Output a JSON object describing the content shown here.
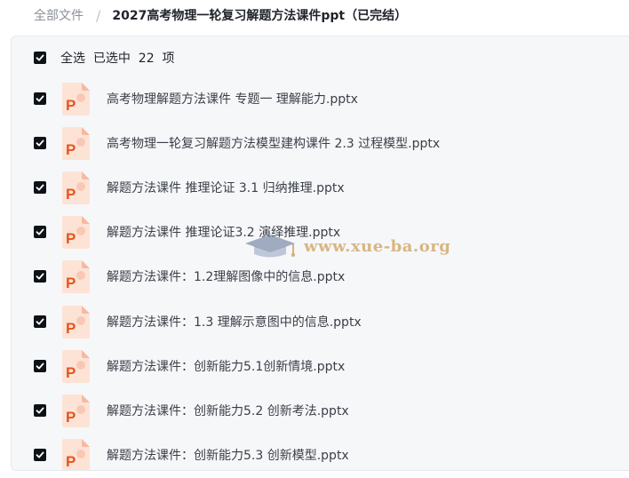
{
  "breadcrumb": {
    "root": "全部文件",
    "separator": "/",
    "current": "2027高考物理一轮复习解题方法课件ppt（已完结）"
  },
  "selection": {
    "label": "全选  已选中  22  项",
    "checked": true
  },
  "files": [
    {
      "name": "高考物理解题方法课件 专题一 理解能力.pptx",
      "icon": "pptx-file-icon",
      "checked": true
    },
    {
      "name": "高考物理一轮复习解题方法模型建构课件 2.3 过程模型.pptx",
      "icon": "pptx-file-icon",
      "checked": true
    },
    {
      "name": "解题方法课件 推理论证 3.1 归纳推理.pptx",
      "icon": "pptx-file-icon",
      "checked": true
    },
    {
      "name": "解题方法课件 推理论证3.2 演绎推理.pptx",
      "icon": "pptx-file-icon",
      "checked": true
    },
    {
      "name": "解题方法课件：1.2理解图像中的信息.pptx",
      "icon": "pptx-file-icon",
      "checked": true
    },
    {
      "name": "解题方法课件：1.3 理解示意图中的信息.pptx",
      "icon": "pptx-file-icon",
      "checked": true
    },
    {
      "name": "解题方法课件：创新能力5.1创新情境.pptx",
      "icon": "pptx-file-icon",
      "checked": true
    },
    {
      "name": "解题方法课件：创新能力5.2 创新考法.pptx",
      "icon": "pptx-file-icon",
      "checked": true
    },
    {
      "name": "解题方法课件：创新能力5.3 创新模型.pptx",
      "icon": "pptx-file-icon",
      "checked": true
    }
  ],
  "watermark": {
    "text": "www.xue-ba.org",
    "icon": "graduation-cap-icon"
  },
  "colors": {
    "checkbox": "#0d1217",
    "panel_bg": "#f6f7f9",
    "ppt_orange": "#e8541e",
    "ppt_light": "#fde3d6"
  }
}
